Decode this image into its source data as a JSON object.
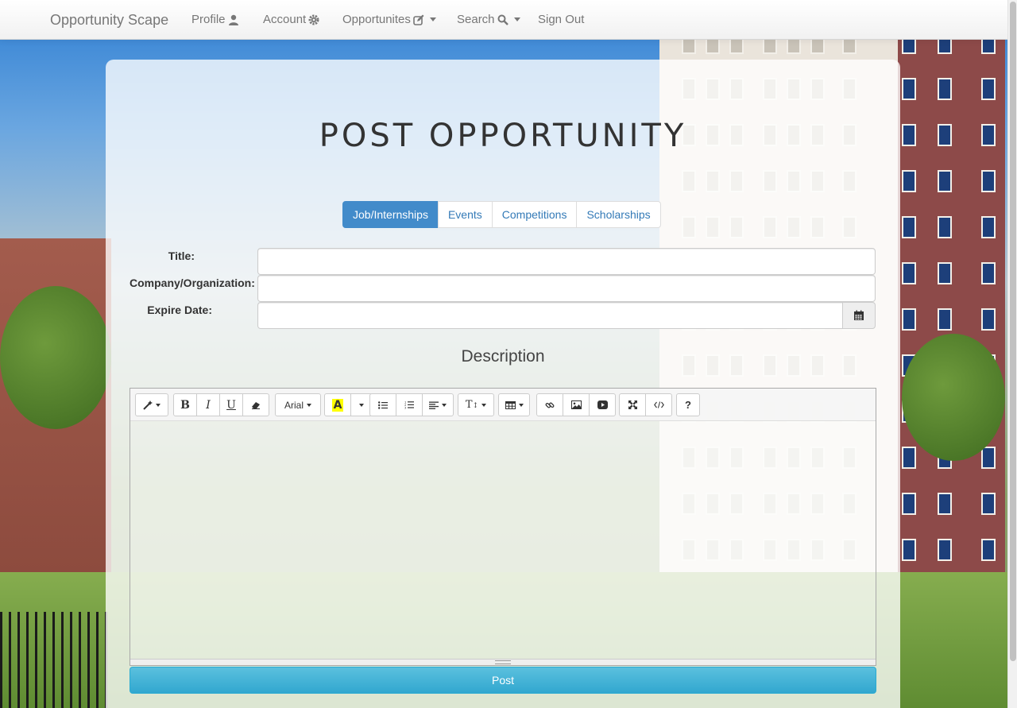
{
  "navbar": {
    "brand": "Opportunity Scape",
    "items": [
      {
        "label": "Profile",
        "icon": "user-icon"
      },
      {
        "label": "Account",
        "icon": "gear-icon"
      },
      {
        "label": "Opportunites",
        "icon": "edit-icon"
      },
      {
        "label": "Search",
        "icon": "search-icon"
      },
      {
        "label": "Sign Out"
      }
    ]
  },
  "page": {
    "title": "Post Opportunity"
  },
  "tabs": [
    "Job/Internships",
    "Events",
    "Competitions",
    "Scholarships"
  ],
  "active_tab": "Job/Internships",
  "form": {
    "title_label": "Title:",
    "company_label": "Company/Organization:",
    "expire_label": "Expire Date:",
    "title_value": "",
    "company_value": "",
    "expire_value": "",
    "description_heading": "Description"
  },
  "editor": {
    "font_name": "Arial",
    "content": ""
  },
  "actions": {
    "post_label": "Post"
  },
  "colors": {
    "accent": "#428bca",
    "post_button": "#5bc0de"
  }
}
